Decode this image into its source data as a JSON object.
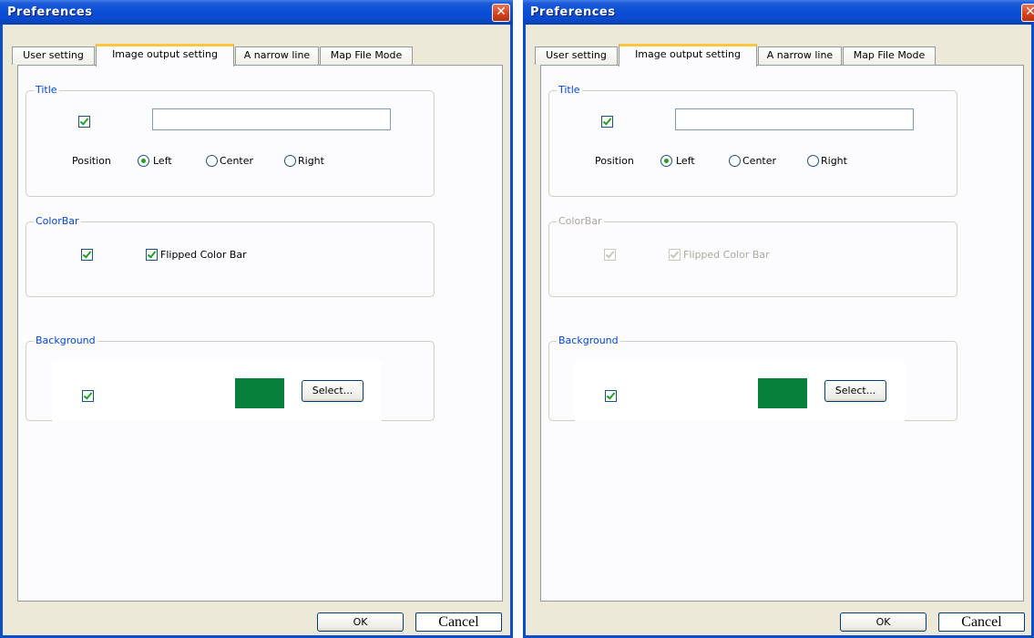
{
  "dialog": {
    "title": "Preferences",
    "close_glyph": "✕",
    "tabs": [
      "User setting",
      "Image output setting",
      "A narrow line",
      "Map File Mode"
    ],
    "active_tab": "Image output setting",
    "title_group": {
      "label": "Title",
      "show_title_checked": true,
      "title_input_value": "",
      "position_label": "Position",
      "position_options": [
        "Left",
        "Center",
        "Right"
      ],
      "position_selected": "Left"
    },
    "colorbar_group": {
      "label": "ColorBar",
      "flipped_label": "Flipped Color Bar"
    },
    "background_group": {
      "label": "Background",
      "swatch_color": "#07803B",
      "select_label": "Select..."
    },
    "ok_label": "OK",
    "cancel_label": "Cancel"
  },
  "windows": [
    {
      "id": "left",
      "colorbar_enabled": true,
      "colorbar_checked": true,
      "flipped_checked": true
    },
    {
      "id": "right",
      "colorbar_enabled": false,
      "colorbar_checked": true,
      "flipped_checked": true
    }
  ],
  "colors": {
    "titlebar_blue": "#0A50D8",
    "close_red": "#D4431E",
    "active_tab_accent": "#FFC83C",
    "group_label_blue": "#0046D5",
    "checkmark_green": "#21A121"
  }
}
